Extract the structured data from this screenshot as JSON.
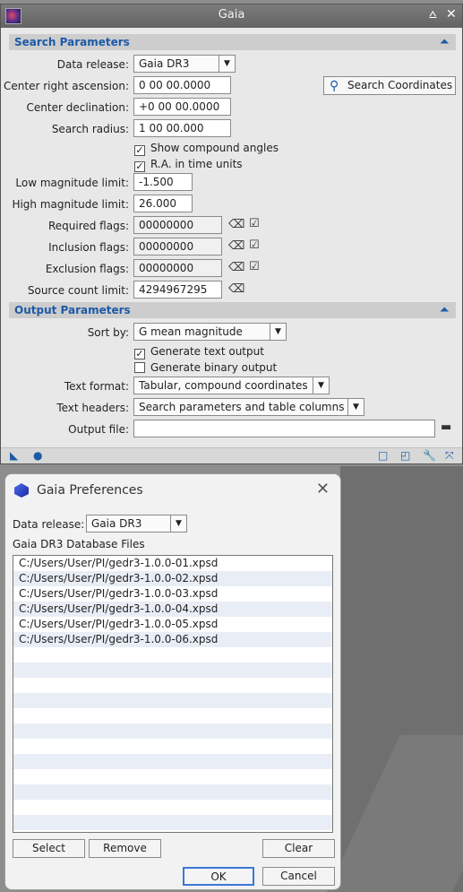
{
  "gaia": {
    "title": "Gaia",
    "search_section": "Search Parameters",
    "labels": {
      "data_release": "Data release:",
      "center_ra": "Center right ascension:",
      "center_dec": "Center declination:",
      "search_radius": "Search radius:",
      "low_mag": "Low magnitude limit:",
      "high_mag": "High magnitude limit:",
      "required_flags": "Required flags:",
      "inclusion_flags": "Inclusion flags:",
      "exclusion_flags": "Exclusion flags:",
      "source_count": "Source count limit:"
    },
    "values": {
      "data_release": "Gaia DR3",
      "center_ra": "0 00 00.0000",
      "center_dec": "+0 00 00.0000",
      "search_radius": "1 00 00.000",
      "low_mag": "-1.500",
      "high_mag": "26.000",
      "required_flags": "00000000",
      "inclusion_flags": "00000000",
      "exclusion_flags": "00000000",
      "source_count": "4294967295"
    },
    "search_button": "Search Coordinates",
    "show_compound_angles": "Show compound angles",
    "ra_time_units": "R.A. in time units",
    "output_section": "Output Parameters",
    "out_labels": {
      "sort_by": "Sort by:",
      "text_format": "Text format:",
      "text_headers": "Text headers:",
      "output_file": "Output file:"
    },
    "out_values": {
      "sort_by": "G mean magnitude",
      "text_format": "Tabular, compound coordinates",
      "text_headers": "Search parameters and table columns",
      "output_file": ""
    },
    "generate_text": "Generate text output",
    "generate_binary": "Generate binary output"
  },
  "prefs": {
    "title": "Gaia Preferences",
    "data_release_label": "Data release:",
    "data_release_value": "Gaia DR3",
    "files_label": "Gaia DR3 Database Files",
    "files": [
      "C:/Users/User/PI/gedr3-1.0.0-01.xpsd",
      "C:/Users/User/PI/gedr3-1.0.0-02.xpsd",
      "C:/Users/User/PI/gedr3-1.0.0-03.xpsd",
      "C:/Users/User/PI/gedr3-1.0.0-04.xpsd",
      "C:/Users/User/PI/gedr3-1.0.0-05.xpsd",
      "C:/Users/User/PI/gedr3-1.0.0-06.xpsd"
    ],
    "buttons": {
      "select": "Select",
      "remove": "Remove",
      "clear": "Clear",
      "ok": "OK",
      "cancel": "Cancel"
    }
  },
  "icons": [
    "gaia-app-icon",
    "shade-icon",
    "close-icon",
    "collapse-icon",
    "search-icon",
    "clear-field-icon",
    "flags-edit-icon",
    "folder-icon",
    "new-instance-icon",
    "apply-global-icon",
    "preview-icon",
    "reset-icon",
    "settings-icon",
    "expand-icon",
    "preferences-app-icon"
  ]
}
